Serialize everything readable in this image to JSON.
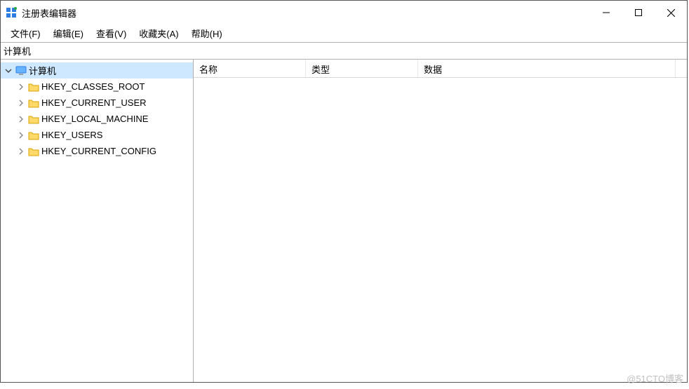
{
  "window": {
    "title": "注册表编辑器"
  },
  "menu": {
    "file": "文件(F)",
    "edit": "编辑(E)",
    "view": "查看(V)",
    "favorites": "收藏夹(A)",
    "help": "帮助(H)"
  },
  "address": {
    "path": "计算机"
  },
  "tree": {
    "root": {
      "label": "计算机",
      "expanded": true
    },
    "hives": [
      {
        "label": "HKEY_CLASSES_ROOT"
      },
      {
        "label": "HKEY_CURRENT_USER"
      },
      {
        "label": "HKEY_LOCAL_MACHINE"
      },
      {
        "label": "HKEY_USERS"
      },
      {
        "label": "HKEY_CURRENT_CONFIG"
      }
    ]
  },
  "columns": {
    "name": "名称",
    "type": "类型",
    "data": "数据"
  },
  "watermark": "@51CTO博客"
}
